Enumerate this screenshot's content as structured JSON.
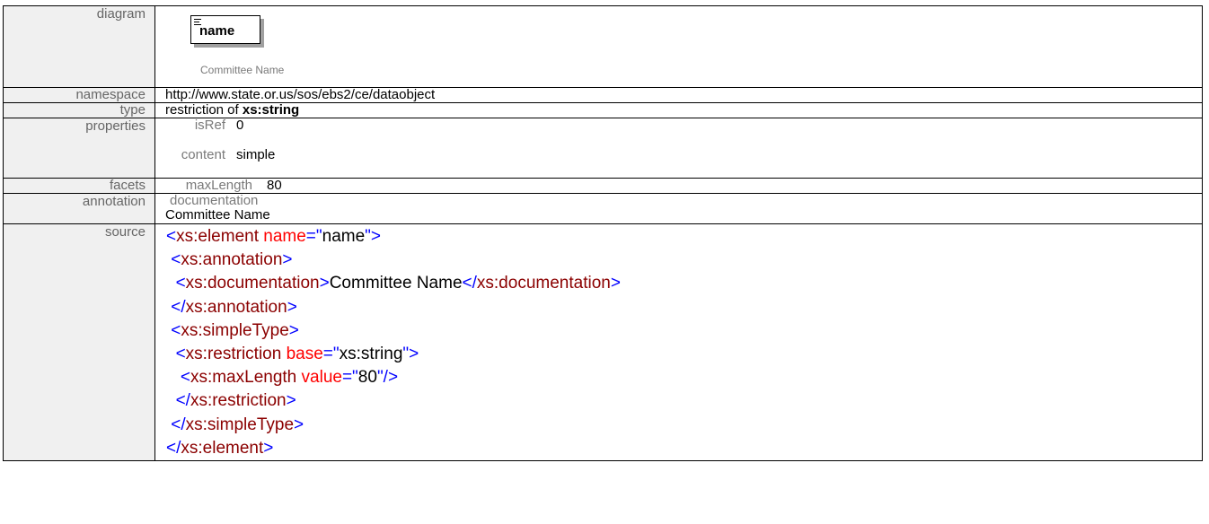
{
  "labels": {
    "diagram": "diagram",
    "namespace": "namespace",
    "type": "type",
    "properties": "properties",
    "facets": "facets",
    "annotation": "annotation",
    "source": "source"
  },
  "diagram": {
    "element_name": "name",
    "documentation": "Committee Name"
  },
  "namespace": "http://www.state.or.us/sos/ebs2/ce/dataobject",
  "type": {
    "prefix": "restriction of ",
    "base": "xs:string"
  },
  "properties": [
    {
      "key": "isRef",
      "value": "0"
    },
    {
      "key": "content",
      "value": "simple"
    }
  ],
  "facets": [
    {
      "key": "maxLength",
      "value": "80"
    }
  ],
  "annotation": {
    "heading": "documentation",
    "text": "Committee Name"
  },
  "source": {
    "lines": [
      [
        {
          "t": "tag",
          "v": "<"
        },
        {
          "t": "name",
          "v": "xs:element"
        },
        {
          "t": "txt",
          "v": " "
        },
        {
          "t": "attr",
          "v": "name"
        },
        {
          "t": "tag",
          "v": "=\""
        },
        {
          "t": "txt",
          "v": "name"
        },
        {
          "t": "tag",
          "v": "\">"
        }
      ],
      [
        {
          "t": "txt",
          "v": " "
        },
        {
          "t": "tag",
          "v": "<"
        },
        {
          "t": "name",
          "v": "xs:annotation"
        },
        {
          "t": "tag",
          "v": ">"
        }
      ],
      [
        {
          "t": "txt",
          "v": "  "
        },
        {
          "t": "tag",
          "v": "<"
        },
        {
          "t": "name",
          "v": "xs:documentation"
        },
        {
          "t": "tag",
          "v": ">"
        },
        {
          "t": "txt",
          "v": "Committee Name"
        },
        {
          "t": "tag",
          "v": "</"
        },
        {
          "t": "name",
          "v": "xs:documentation"
        },
        {
          "t": "tag",
          "v": ">"
        }
      ],
      [
        {
          "t": "txt",
          "v": " "
        },
        {
          "t": "tag",
          "v": "</"
        },
        {
          "t": "name",
          "v": "xs:annotation"
        },
        {
          "t": "tag",
          "v": ">"
        }
      ],
      [
        {
          "t": "txt",
          "v": " "
        },
        {
          "t": "tag",
          "v": "<"
        },
        {
          "t": "name",
          "v": "xs:simpleType"
        },
        {
          "t": "tag",
          "v": ">"
        }
      ],
      [
        {
          "t": "txt",
          "v": "  "
        },
        {
          "t": "tag",
          "v": "<"
        },
        {
          "t": "name",
          "v": "xs:restriction"
        },
        {
          "t": "txt",
          "v": " "
        },
        {
          "t": "attr",
          "v": "base"
        },
        {
          "t": "tag",
          "v": "=\""
        },
        {
          "t": "txt",
          "v": "xs:string"
        },
        {
          "t": "tag",
          "v": "\">"
        }
      ],
      [
        {
          "t": "txt",
          "v": "   "
        },
        {
          "t": "tag",
          "v": "<"
        },
        {
          "t": "name",
          "v": "xs:maxLength"
        },
        {
          "t": "txt",
          "v": " "
        },
        {
          "t": "attr",
          "v": "value"
        },
        {
          "t": "tag",
          "v": "=\""
        },
        {
          "t": "txt",
          "v": "80"
        },
        {
          "t": "tag",
          "v": "\"/>"
        }
      ],
      [
        {
          "t": "txt",
          "v": "  "
        },
        {
          "t": "tag",
          "v": "</"
        },
        {
          "t": "name",
          "v": "xs:restriction"
        },
        {
          "t": "tag",
          "v": ">"
        }
      ],
      [
        {
          "t": "txt",
          "v": " "
        },
        {
          "t": "tag",
          "v": "</"
        },
        {
          "t": "name",
          "v": "xs:simpleType"
        },
        {
          "t": "tag",
          "v": ">"
        }
      ],
      [
        {
          "t": "tag",
          "v": "</"
        },
        {
          "t": "name",
          "v": "xs:element"
        },
        {
          "t": "tag",
          "v": ">"
        }
      ]
    ]
  },
  "colors": {
    "label_bg": "#f0f0f0",
    "label_text": "#666666",
    "tag": "#0000ff",
    "element_name": "#8b0000",
    "attribute": "#ff0000"
  }
}
